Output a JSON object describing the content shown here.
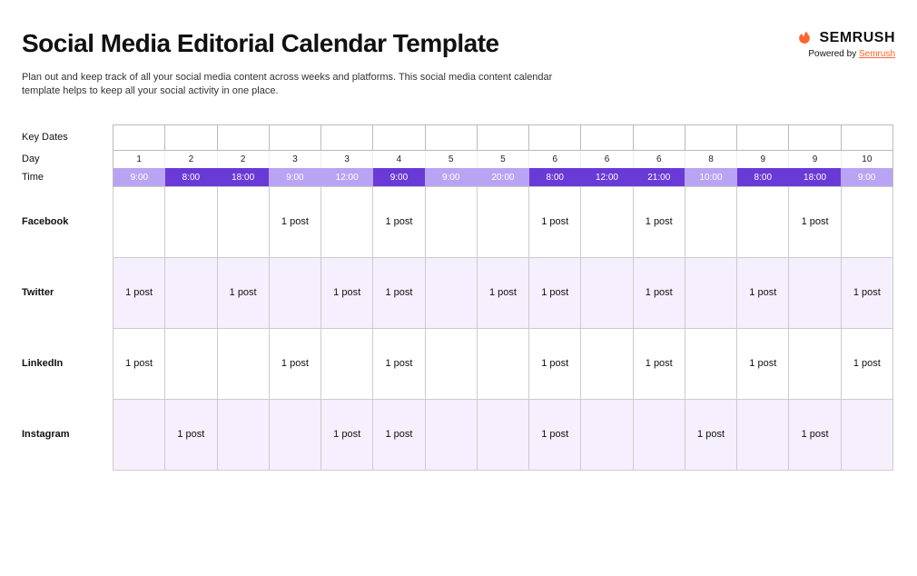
{
  "title": "Social Media Editorial Calendar Template",
  "brand": {
    "name_text": "SEMRUSH",
    "powered_prefix": "Powered by ",
    "powered_link": "Semrush"
  },
  "subtitle": "Plan out and keep track of all your social media content across weeks and platforms. This social media content calendar template helps to keep all your social activity in one place.",
  "row_labels": {
    "key_dates": "Key Dates",
    "day": "Day",
    "time": "Time"
  },
  "slots": [
    {
      "day": "1",
      "time": "9:00",
      "shade": "light"
    },
    {
      "day": "2",
      "time": "8:00",
      "shade": "dark"
    },
    {
      "day": "2",
      "time": "18:00",
      "shade": "dark"
    },
    {
      "day": "3",
      "time": "9:00",
      "shade": "light"
    },
    {
      "day": "3",
      "time": "12:00",
      "shade": "light"
    },
    {
      "day": "4",
      "time": "9:00",
      "shade": "dark"
    },
    {
      "day": "5",
      "time": "9:00",
      "shade": "light"
    },
    {
      "day": "5",
      "time": "20:00",
      "shade": "light"
    },
    {
      "day": "6",
      "time": "8:00",
      "shade": "dark"
    },
    {
      "day": "6",
      "time": "12:00",
      "shade": "dark"
    },
    {
      "day": "6",
      "time": "21:00",
      "shade": "dark"
    },
    {
      "day": "8",
      "time": "10:00",
      "shade": "light"
    },
    {
      "day": "9",
      "time": "8:00",
      "shade": "dark"
    },
    {
      "day": "9",
      "time": "18:00",
      "shade": "dark"
    },
    {
      "day": "10",
      "time": "9:00",
      "shade": "light"
    }
  ],
  "platforms": [
    {
      "name": "Facebook",
      "tint": false,
      "cells": [
        "",
        "",
        "",
        "1 post",
        "",
        "1 post",
        "",
        "",
        "1 post",
        "",
        "1 post",
        "",
        "",
        "1 post",
        ""
      ]
    },
    {
      "name": "Twitter",
      "tint": true,
      "cells": [
        "1 post",
        "",
        "1 post",
        "",
        "1 post",
        "1 post",
        "",
        "1 post",
        "1 post",
        "",
        "1 post",
        "",
        "1 post",
        "",
        "1 post"
      ]
    },
    {
      "name": "LinkedIn",
      "tint": false,
      "cells": [
        "1 post",
        "",
        "",
        "1 post",
        "",
        "1 post",
        "",
        "",
        "1 post",
        "",
        "1 post",
        "",
        "1 post",
        "",
        "1 post"
      ]
    },
    {
      "name": "Instagram",
      "tint": true,
      "cells": [
        "",
        "1 post",
        "",
        "",
        "1 post",
        "1 post",
        "",
        "",
        "1 post",
        "",
        "",
        "1 post",
        "",
        "1 post",
        ""
      ]
    }
  ],
  "chart_data": {
    "type": "table",
    "title": "Social Media Editorial Calendar Template",
    "columns": [
      {
        "day": 1,
        "time": "9:00"
      },
      {
        "day": 2,
        "time": "8:00"
      },
      {
        "day": 2,
        "time": "18:00"
      },
      {
        "day": 3,
        "time": "9:00"
      },
      {
        "day": 3,
        "time": "12:00"
      },
      {
        "day": 4,
        "time": "9:00"
      },
      {
        "day": 5,
        "time": "9:00"
      },
      {
        "day": 5,
        "time": "20:00"
      },
      {
        "day": 6,
        "time": "8:00"
      },
      {
        "day": 6,
        "time": "12:00"
      },
      {
        "day": 6,
        "time": "21:00"
      },
      {
        "day": 8,
        "time": "10:00"
      },
      {
        "day": 9,
        "time": "8:00"
      },
      {
        "day": 9,
        "time": "18:00"
      },
      {
        "day": 10,
        "time": "9:00"
      }
    ],
    "rows": {
      "Facebook": [
        0,
        0,
        0,
        1,
        0,
        1,
        0,
        0,
        1,
        0,
        1,
        0,
        0,
        1,
        0
      ],
      "Twitter": [
        1,
        0,
        1,
        0,
        1,
        1,
        0,
        1,
        1,
        0,
        1,
        0,
        1,
        0,
        1
      ],
      "LinkedIn": [
        1,
        0,
        0,
        1,
        0,
        1,
        0,
        0,
        1,
        0,
        1,
        0,
        1,
        0,
        1
      ],
      "Instagram": [
        0,
        1,
        0,
        0,
        1,
        1,
        0,
        0,
        1,
        0,
        0,
        1,
        0,
        1,
        0
      ]
    },
    "cell_value_label": "1 post"
  }
}
